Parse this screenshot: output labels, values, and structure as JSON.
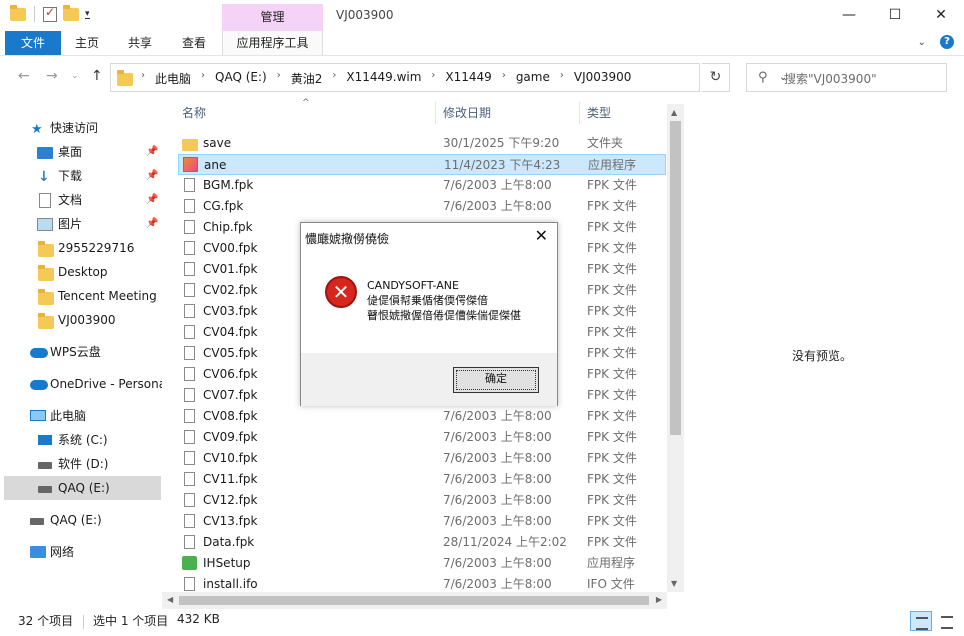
{
  "window": {
    "title": "VJ003900",
    "manage_tab": "管理"
  },
  "ribbon": {
    "tabs": [
      "文件",
      "主页",
      "共享",
      "查看",
      "应用程序工具"
    ]
  },
  "address": {
    "crumbs": [
      "此电脑",
      "QAQ (E:)",
      "黄油2",
      "X11449.wim",
      "X11449",
      "game",
      "VJ003900"
    ],
    "search_placeholder": "搜索\"VJ003900\""
  },
  "sidebar": {
    "items": [
      {
        "label": "快速访问",
        "icon": "star-icon",
        "pinned": false
      },
      {
        "label": "桌面",
        "icon": "desktop-icon",
        "pinned": true
      },
      {
        "label": "下载",
        "icon": "download-icon",
        "pinned": true
      },
      {
        "label": "文档",
        "icon": "document-icon",
        "pinned": true
      },
      {
        "label": "图片",
        "icon": "pictures-icon",
        "pinned": true
      },
      {
        "label": "2955229716",
        "icon": "folder-icon",
        "pinned": false
      },
      {
        "label": "Desktop",
        "icon": "folder-icon",
        "pinned": false
      },
      {
        "label": "Tencent Meeting",
        "icon": "folder-icon",
        "pinned": false
      },
      {
        "label": "VJ003900",
        "icon": "folder-icon",
        "pinned": false
      },
      {
        "label": "WPS云盘",
        "icon": "cloud-icon",
        "pinned": false
      },
      {
        "label": "OneDrive - Persona",
        "icon": "onedrive-icon",
        "pinned": false
      },
      {
        "label": "此电脑",
        "icon": "pc-icon",
        "pinned": false
      },
      {
        "label": "系统 (C:)",
        "icon": "drive-icon",
        "pinned": false
      },
      {
        "label": "软件 (D:)",
        "icon": "drive-icon",
        "pinned": false
      },
      {
        "label": "QAQ (E:)",
        "icon": "drive-icon",
        "pinned": false,
        "selected": true
      },
      {
        "label": "QAQ (E:)",
        "icon": "drive-icon",
        "pinned": false
      },
      {
        "label": "网络",
        "icon": "network-icon",
        "pinned": false
      }
    ]
  },
  "columns": {
    "name": "名称",
    "date": "修改日期",
    "type": "类型"
  },
  "files": [
    {
      "name": "save",
      "date": "30/1/2025 下午9:20",
      "type": "文件夹",
      "icon": "folder-icon"
    },
    {
      "name": "ane",
      "date": "11/4/2023 下午4:23",
      "type": "应用程序",
      "icon": "app-icon",
      "selected": true
    },
    {
      "name": "BGM.fpk",
      "date": "7/6/2003 上午8:00",
      "type": "FPK 文件",
      "icon": "file-icon"
    },
    {
      "name": "CG.fpk",
      "date": "7/6/2003 上午8:00",
      "type": "FPK 文件",
      "icon": "file-icon"
    },
    {
      "name": "Chip.fpk",
      "date": "",
      "type": "FPK 文件",
      "icon": "file-icon"
    },
    {
      "name": "CV00.fpk",
      "date": "",
      "type": "FPK 文件",
      "icon": "file-icon"
    },
    {
      "name": "CV01.fpk",
      "date": "",
      "type": "FPK 文件",
      "icon": "file-icon"
    },
    {
      "name": "CV02.fpk",
      "date": "",
      "type": "FPK 文件",
      "icon": "file-icon"
    },
    {
      "name": "CV03.fpk",
      "date": "",
      "type": "FPK 文件",
      "icon": "file-icon"
    },
    {
      "name": "CV04.fpk",
      "date": "",
      "type": "FPK 文件",
      "icon": "file-icon"
    },
    {
      "name": "CV05.fpk",
      "date": "",
      "type": "FPK 文件",
      "icon": "file-icon"
    },
    {
      "name": "CV06.fpk",
      "date": "",
      "type": "FPK 文件",
      "icon": "file-icon"
    },
    {
      "name": "CV07.fpk",
      "date": "",
      "type": "FPK 文件",
      "icon": "file-icon"
    },
    {
      "name": "CV08.fpk",
      "date": "7/6/2003 上午8:00",
      "type": "FPK 文件",
      "icon": "file-icon"
    },
    {
      "name": "CV09.fpk",
      "date": "7/6/2003 上午8:00",
      "type": "FPK 文件",
      "icon": "file-icon"
    },
    {
      "name": "CV10.fpk",
      "date": "7/6/2003 上午8:00",
      "type": "FPK 文件",
      "icon": "file-icon"
    },
    {
      "name": "CV11.fpk",
      "date": "7/6/2003 上午8:00",
      "type": "FPK 文件",
      "icon": "file-icon"
    },
    {
      "name": "CV12.fpk",
      "date": "7/6/2003 上午8:00",
      "type": "FPK 文件",
      "icon": "file-icon"
    },
    {
      "name": "CV13.fpk",
      "date": "7/6/2003 上午8:00",
      "type": "FPK 文件",
      "icon": "file-icon"
    },
    {
      "name": "Data.fpk",
      "date": "28/11/2024 上午2:02",
      "type": "FPK 文件",
      "icon": "file-icon"
    },
    {
      "name": "IHSetup",
      "date": "7/6/2003 上午8:00",
      "type": "应用程序",
      "icon": "setup-icon"
    },
    {
      "name": "install.ifo",
      "date": "7/6/2003 上午8:00",
      "type": "IFO 文件",
      "icon": "file-icon"
    }
  ],
  "preview": {
    "text": "没有预览。"
  },
  "status": {
    "count": "32 个项目",
    "selected": "选中 1 个项目",
    "size": "432 KB"
  },
  "dialog": {
    "title": "憹廰婋擏僗僥儉",
    "lines": [
      "CANDYSOFT-ANE",
      "偼偍傊幇乗偱偖偄偔傑偣",
      "瞽恨婋擏偓偣倦偍傮偨偳偍傑偡"
    ],
    "ok_label": "确定"
  },
  "colors": {
    "accent": "#1979ca",
    "manage_tab": "#f5d3f6",
    "selection": "#cce8ff",
    "error": "#d7261d"
  }
}
